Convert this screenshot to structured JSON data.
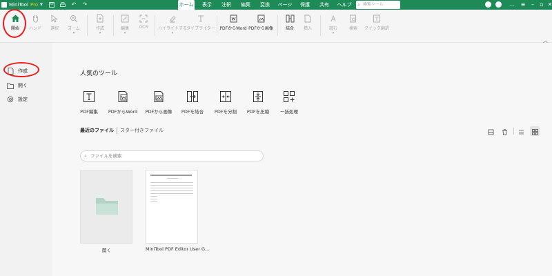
{
  "titlebar": {
    "app_name": "MiniTool",
    "edition": "Pro",
    "menus": [
      "ホーム",
      "表示",
      "注釈",
      "編集",
      "変換",
      "ページ",
      "保護",
      "共有",
      "ヘルプ"
    ],
    "active_menu_index": 0,
    "search_placeholder": "検索ツール",
    "colors": {
      "brand": "#1e8a57",
      "edition": "#f0c419"
    }
  },
  "ribbon": {
    "buttons": [
      {
        "label": "開始",
        "icon": "home-icon",
        "enabled": true,
        "dropdown": false
      },
      {
        "label": "ハンド",
        "icon": "hand-icon",
        "enabled": false,
        "dropdown": false
      },
      {
        "label": "選択",
        "icon": "cursor-icon",
        "enabled": false,
        "dropdown": false
      },
      {
        "label": "ズーム",
        "icon": "zoom-icon",
        "enabled": false,
        "dropdown": true
      },
      {
        "label": "作成",
        "icon": "create-icon",
        "enabled": false,
        "dropdown": true
      },
      {
        "label": "編集",
        "icon": "edit-icon",
        "enabled": false,
        "dropdown": true
      },
      {
        "label": "OCR",
        "icon": "ocr-icon",
        "enabled": false,
        "dropdown": false
      },
      {
        "label": "ハイライトする",
        "icon": "highlight-icon",
        "enabled": false,
        "dropdown": true
      },
      {
        "label": "タイプライター",
        "icon": "typewriter-icon",
        "enabled": false,
        "dropdown": false
      },
      {
        "label": "PDFからWord",
        "icon": "pdf-to-word-icon",
        "enabled": true,
        "dropdown": false
      },
      {
        "label": "PDFから画像",
        "icon": "pdf-to-image-icon",
        "enabled": true,
        "dropdown": false
      },
      {
        "label": "結合",
        "icon": "merge-icon",
        "enabled": true,
        "dropdown": false
      },
      {
        "label": "挿入",
        "icon": "insert-icon",
        "enabled": false,
        "dropdown": false
      },
      {
        "label": "読む",
        "icon": "read-aloud-icon",
        "enabled": false,
        "dropdown": true
      },
      {
        "label": "検索",
        "icon": "search-doc-icon",
        "enabled": false,
        "dropdown": false
      },
      {
        "label": "クイック翻訳",
        "icon": "translate-icon",
        "enabled": false,
        "dropdown": false
      }
    ]
  },
  "sidebar": {
    "items": [
      {
        "label": "作成",
        "icon": "new-file-icon"
      },
      {
        "label": "開く",
        "icon": "open-folder-icon"
      },
      {
        "label": "設定",
        "icon": "gear-icon"
      }
    ]
  },
  "popular": {
    "title": "人気のツール",
    "tools": [
      {
        "label": "PDF編集",
        "icon": "pdf-edit-icon"
      },
      {
        "label": "PDFからWord",
        "icon": "pdf-to-word-icon"
      },
      {
        "label": "PDFから画像",
        "icon": "pdf-to-image-icon"
      },
      {
        "label": "PDFを結合",
        "icon": "pdf-merge-icon"
      },
      {
        "label": "PDFを分割",
        "icon": "pdf-split-icon"
      },
      {
        "label": "PDFを圧縮",
        "icon": "pdf-compress-icon"
      },
      {
        "label": "一括処理",
        "icon": "batch-icon"
      }
    ]
  },
  "files": {
    "tab_recent": "最近のファイル",
    "tab_starred": "スター付きファイル",
    "view_mode": "grid",
    "search_placeholder": "ファイルを検索",
    "cards": [
      {
        "label": "開く",
        "type": "open-folder"
      },
      {
        "label": "MiniTool PDF Editor User G...",
        "type": "document"
      }
    ]
  },
  "annotation_color": "#ec1c1c"
}
